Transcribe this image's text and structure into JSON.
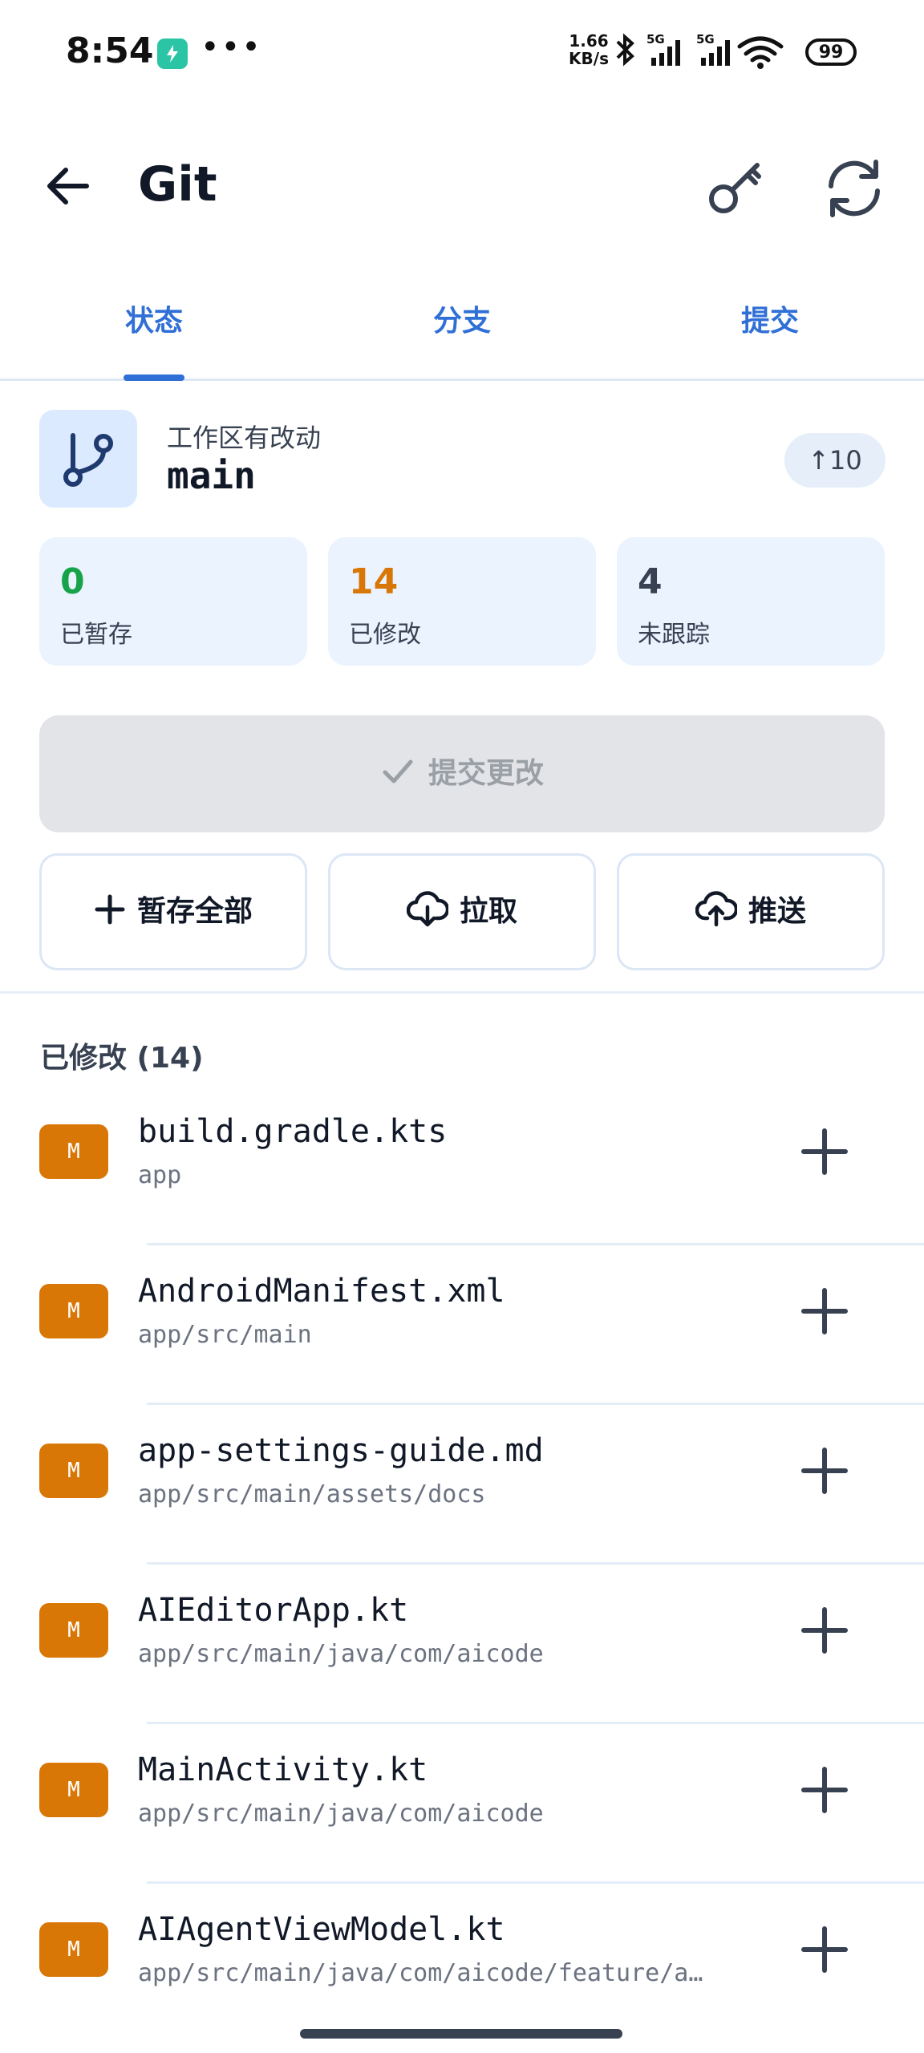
{
  "status_bar": {
    "time": "8:54",
    "dots": "•••",
    "net_speed_value": "1.66",
    "net_speed_unit": "KB/s",
    "signal_1_label": "5G",
    "signal_2_label": "5G",
    "battery": "99"
  },
  "app_bar": {
    "title": "Git",
    "icons": [
      "arrow-back-icon",
      "key-icon",
      "sync-icon"
    ]
  },
  "tabs": [
    {
      "label": "状态",
      "selected": true
    },
    {
      "label": "分支",
      "selected": false
    },
    {
      "label": "提交",
      "selected": false
    }
  ],
  "branch": {
    "status_text": "工作区有改动",
    "name": "main",
    "ahead_count": "10"
  },
  "stats": [
    {
      "value": "0",
      "label": "已暂存",
      "color": "#16a34a"
    },
    {
      "value": "14",
      "label": "已修改",
      "color": "#d97706"
    },
    {
      "value": "4",
      "label": "未跟踪",
      "color": "#374151"
    }
  ],
  "commit_button": {
    "label": "提交更改",
    "enabled": false
  },
  "actions": [
    {
      "label": "暂存全部",
      "icon": "plus-icon"
    },
    {
      "label": "拉取",
      "icon": "cloud-download-icon"
    },
    {
      "label": "推送",
      "icon": "cloud-upload-icon"
    }
  ],
  "modified_section": {
    "title": "已修改 (14)",
    "badge": "M",
    "files": [
      {
        "name": "build.gradle.kts",
        "path": "app"
      },
      {
        "name": "AndroidManifest.xml",
        "path": "app/src/main"
      },
      {
        "name": "app-settings-guide.md",
        "path": "app/src/main/assets/docs"
      },
      {
        "name": "AIEditorApp.kt",
        "path": "app/src/main/java/com/aicode"
      },
      {
        "name": "MainActivity.kt",
        "path": "app/src/main/java/com/aicode"
      },
      {
        "name": "AIAgentViewModel.kt",
        "path": "app/src/main/java/com/aicode/feature/a…"
      }
    ]
  },
  "colors": {
    "accent": "#2f6fd6",
    "modified_badge": "#d97706",
    "card_bg": "#eaf3fe"
  }
}
